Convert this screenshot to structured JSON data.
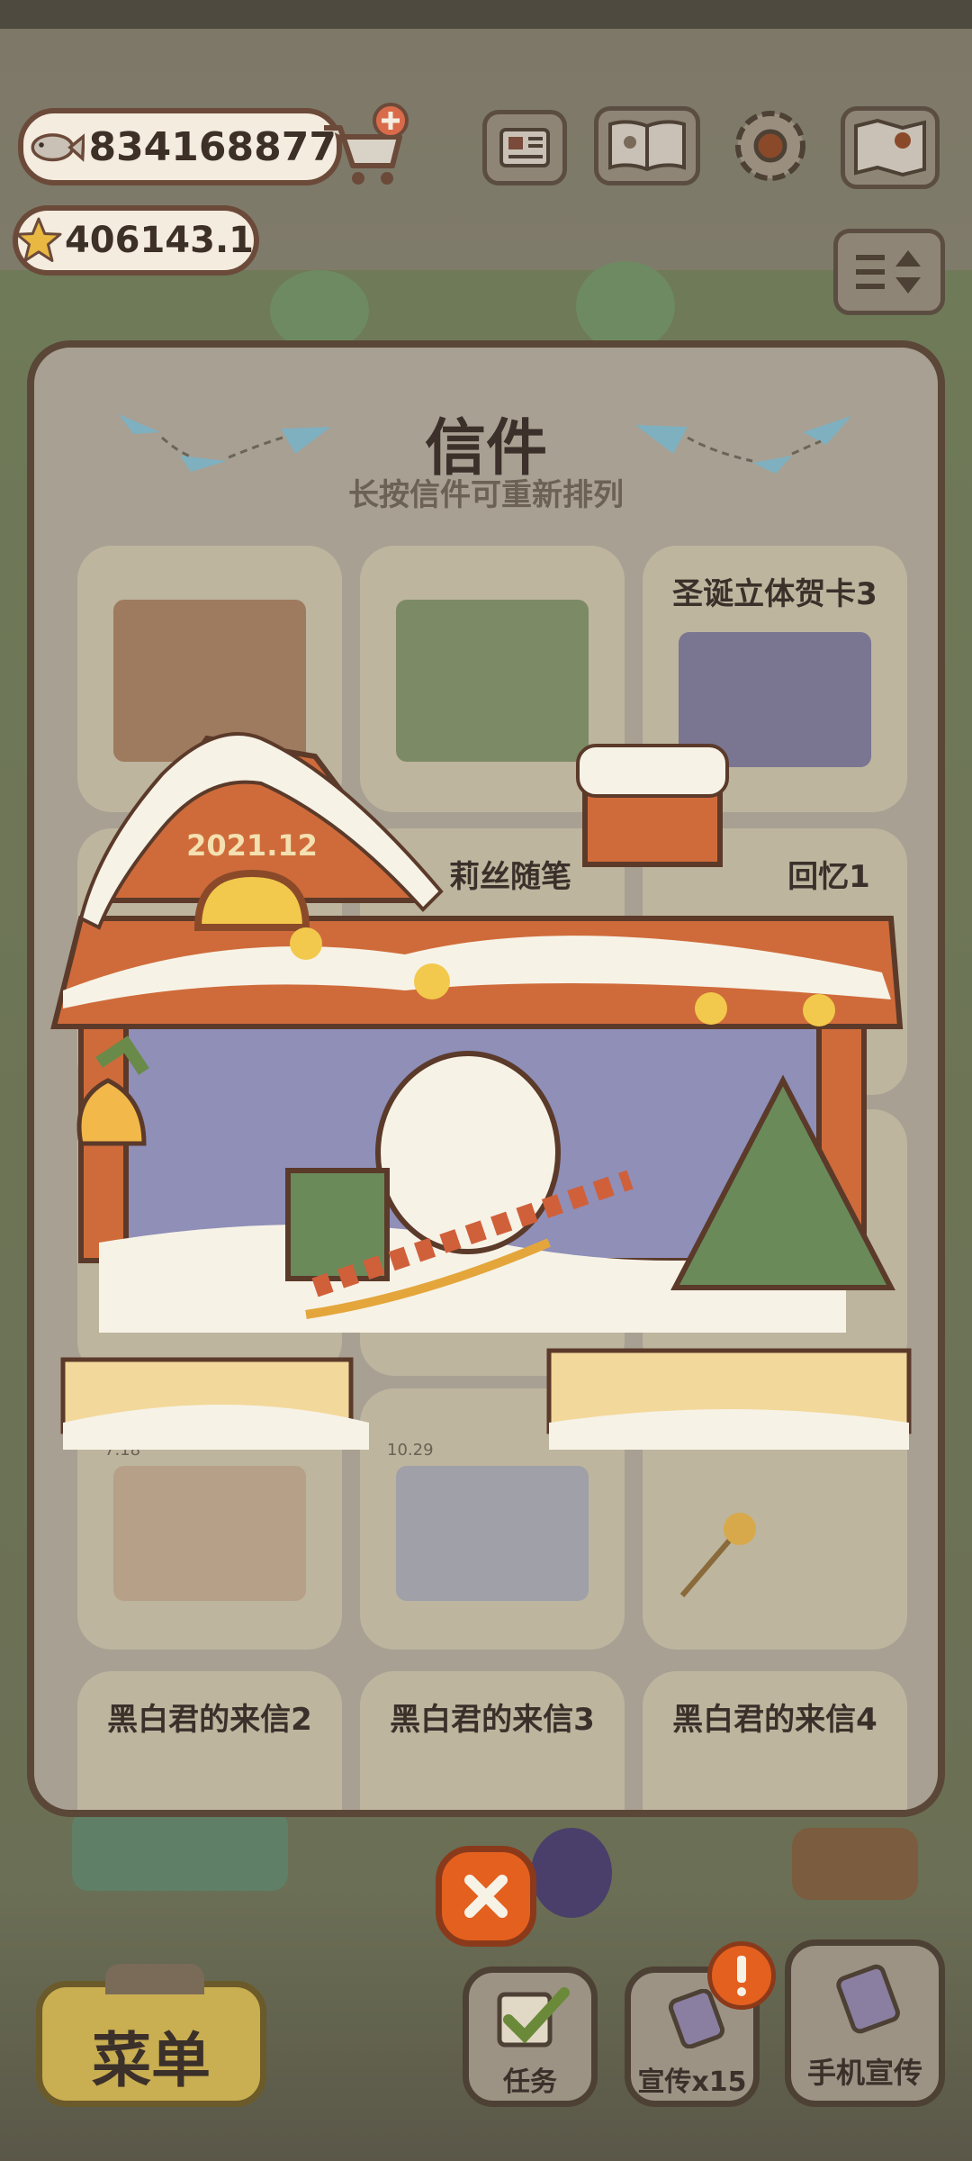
{
  "currency": {
    "fish": "834168877",
    "stars": "406143.1"
  },
  "modal": {
    "title": "信件",
    "subtitle": "长按信件可重新排列",
    "cards": [
      {
        "title": ""
      },
      {
        "title": ""
      },
      {
        "title": "圣诞立体贺卡3"
      },
      {
        "title": ""
      },
      {
        "title": "莉丝随笔"
      },
      {
        "title": "回忆1"
      },
      {
        "title": ""
      },
      {
        "title": ""
      },
      {
        "title": ""
      },
      {
        "title": "黑白君的来信2"
      },
      {
        "title": "黑白君的来信3"
      },
      {
        "title": "黑白君的来信4"
      }
    ],
    "card_dates": [
      "7.18",
      "10.29"
    ]
  },
  "overlay": {
    "roof_date": "2021.12"
  },
  "bottom": {
    "menu_label": "菜单",
    "task_label": "任务",
    "promo_label": "宣传x15",
    "phone_promo_label": "手机宣传"
  },
  "icons": [
    "fish-icon",
    "cart-icon",
    "star-icon",
    "newspaper-icon",
    "book-icon",
    "gear-icon",
    "map-icon",
    "sort-icon",
    "close-icon",
    "checkbox-icon",
    "alert-icon"
  ],
  "colors": {
    "accent": "#e4601f",
    "panel": "#a8a092",
    "border": "#5b4737"
  }
}
